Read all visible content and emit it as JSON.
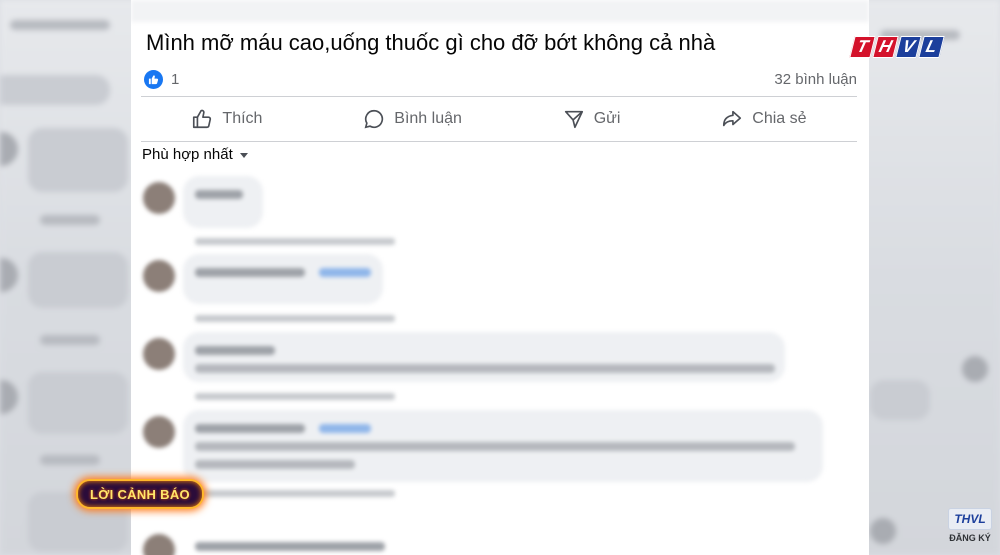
{
  "post": {
    "text": "Mình mỡ máu cao,uống thuốc gì cho đỡ bớt không cả nhà",
    "like_count": "1",
    "comment_count": "32 bình luận"
  },
  "actions": {
    "like_label": "Thích",
    "comment_label": "Bình luận",
    "send_label": "Gửi",
    "share_label": "Chia sẻ"
  },
  "sort": {
    "label": "Phù hợp nhất"
  },
  "channel": {
    "logo_letters": [
      "T",
      "H",
      "V",
      "L"
    ],
    "warning_label": "LỜI CẢNH BÁO",
    "subscribe_logo": "THVL",
    "subscribe_label": "ĐĂNG KÝ"
  },
  "colors": {
    "facebook_blue": "#1877f2",
    "text_primary": "#050505",
    "text_secondary": "#65676b",
    "logo_red": "#d4122b",
    "logo_blue": "#1c3f9c",
    "banner_glow": "#ff7a1a"
  }
}
